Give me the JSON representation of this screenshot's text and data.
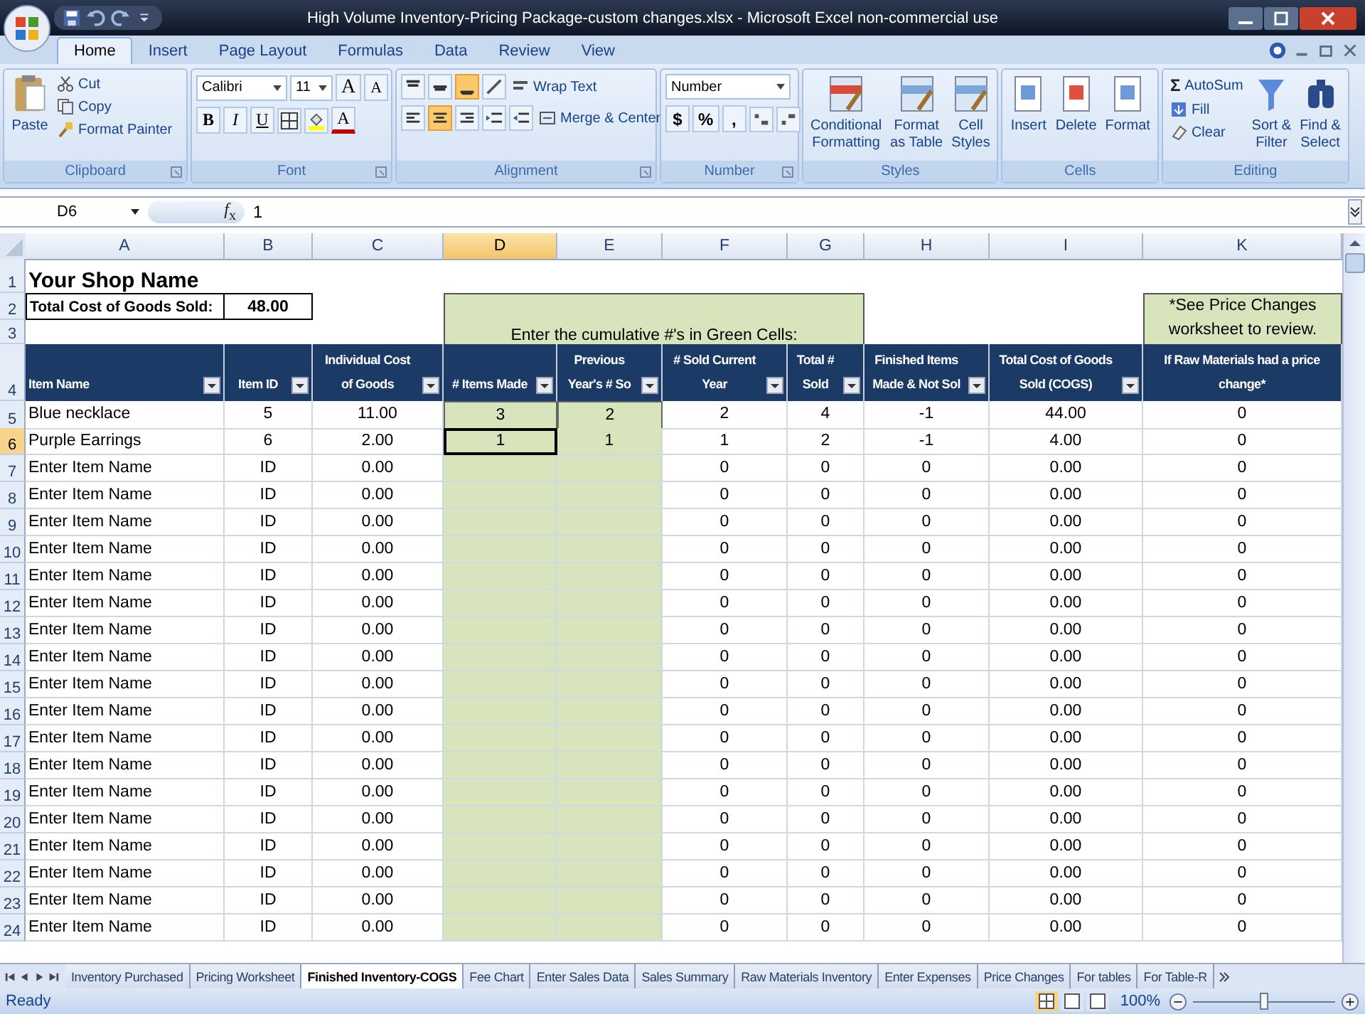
{
  "window": {
    "title": "High Volume Inventory-Pricing Package-custom changes.xlsx - Microsoft Excel non-commercial use"
  },
  "ribbon_tabs": [
    {
      "label": "Home",
      "selected": true
    },
    {
      "label": "Insert",
      "selected": false
    },
    {
      "label": "Page Layout",
      "selected": false
    },
    {
      "label": "Formulas",
      "selected": false
    },
    {
      "label": "Data",
      "selected": false
    },
    {
      "label": "Review",
      "selected": false
    },
    {
      "label": "View",
      "selected": false
    }
  ],
  "ribbon": {
    "clipboard": {
      "paste": "Paste",
      "items": [
        "Cut",
        "Copy",
        "Format Painter"
      ],
      "label": "Clipboard"
    },
    "font": {
      "font_name": "Calibri",
      "font_size": "11",
      "grow": "A",
      "shrink": "A",
      "styles": [
        "B",
        "I",
        "U"
      ],
      "font_color": "A",
      "label": "Font"
    },
    "alignment": {
      "vertical": [
        {
          "selected": false
        },
        {
          "selected": false
        },
        {
          "selected": true
        }
      ],
      "horizontal": [
        {
          "selected": false
        },
        {
          "selected": true
        },
        {
          "selected": false
        }
      ],
      "wrap_text": "Wrap Text",
      "merge": "Merge & Center",
      "label": "Alignment"
    },
    "number": {
      "format": "Number",
      "symbols": [
        "$",
        "%",
        ","
      ],
      "label": "Number"
    },
    "styles": {
      "buttons": [
        {
          "lines": [
            "Conditional",
            "Formatting"
          ]
        },
        {
          "lines": [
            "Format",
            "as Table"
          ]
        },
        {
          "lines": [
            "Cell",
            "Styles"
          ]
        }
      ],
      "label": "Styles"
    },
    "cells": {
      "buttons": [
        "Insert",
        "Delete",
        "Format"
      ],
      "label": "Cells"
    },
    "editing": {
      "sigma": "Σ",
      "autosum": "AutoSum",
      "fill": "Fill",
      "clear": "Clear",
      "buttons": [
        {
          "lines": [
            "Sort &",
            "Filter"
          ]
        },
        {
          "lines": [
            "Find &",
            "Select"
          ]
        }
      ],
      "label": "Editing"
    }
  },
  "formula_bar": {
    "name_box": "D6",
    "fx": "*f*$_{x}$",
    "value": "1"
  },
  "columns": [
    {
      "label": "A",
      "selected": false
    },
    {
      "label": "B",
      "selected": false
    },
    {
      "label": "C",
      "selected": false
    },
    {
      "label": "D",
      "selected": true
    },
    {
      "label": "E",
      "selected": false
    },
    {
      "label": "F",
      "selected": false
    },
    {
      "label": "G",
      "selected": false
    },
    {
      "label": "H",
      "selected": false
    },
    {
      "label": "I",
      "selected": false
    },
    {
      "label": "K",
      "selected": false
    }
  ],
  "sheet": {
    "title_row": {
      "number": "1",
      "text": "Your Shop Name"
    },
    "total_row": {
      "number": "2",
      "label": "Total Cost of Goods Sold:",
      "value": "48.00"
    },
    "spacer_row": {
      "number": "3"
    },
    "green_banner": "Enter the cumulative #'s in Green Cells:",
    "note": "*See Price Changes worksheet to review.",
    "header_row": {
      "number": "4",
      "cells": [
        {
          "lines": [
            "Item Name"
          ],
          "filter": true
        },
        {
          "lines": [
            "Item ID"
          ],
          "filter": true
        },
        {
          "lines": [
            "Individual Cost",
            "of Goods"
          ],
          "filter": true
        },
        {
          "lines": [
            "# Items Made"
          ],
          "filter": true
        },
        {
          "lines": [
            "Previous",
            "Year's # So"
          ],
          "filter": true
        },
        {
          "lines": [
            "# Sold Current",
            "Year"
          ],
          "filter": true
        },
        {
          "lines": [
            "Total #",
            "Sold"
          ],
          "filter": true
        },
        {
          "lines": [
            "Finished Items",
            "Made & Not Sol"
          ],
          "filter": true
        },
        {
          "lines": [
            "Total Cost of Goods",
            "Sold (COGS)"
          ],
          "filter": true
        },
        {
          "lines": [
            "If Raw Materials had a price",
            "change*"
          ],
          "filter": false
        }
      ]
    },
    "rows": [
      {
        "number": "5",
        "selected": false,
        "item_name": "Blue necklace",
        "item_id": "5",
        "cost": "11.00",
        "items_made": "3",
        "previous_sold": "2",
        "sold_current": "2",
        "total_sold": "4",
        "not_sold": "-1",
        "cogs": "44.00",
        "price_change": "0"
      },
      {
        "number": "6",
        "selected": true,
        "item_name": "Purple Earrings",
        "item_id": "6",
        "cost": "2.00",
        "items_made": "1",
        "previous_sold": "1",
        "sold_current": "1",
        "total_sold": "2",
        "not_sold": "-1",
        "cogs": "4.00",
        "price_change": "0"
      },
      {
        "number": "7",
        "selected": false,
        "item_name": "Enter Item Name",
        "item_id": "ID",
        "cost": "0.00",
        "sold_current": "0",
        "total_sold": "0",
        "not_sold": "0",
        "cogs": "0.00",
        "price_change": "0"
      },
      {
        "number": "8",
        "selected": false,
        "item_name": "Enter Item Name",
        "item_id": "ID",
        "cost": "0.00",
        "sold_current": "0",
        "total_sold": "0",
        "not_sold": "0",
        "cogs": "0.00",
        "price_change": "0"
      },
      {
        "number": "9",
        "selected": false,
        "item_name": "Enter Item Name",
        "item_id": "ID",
        "cost": "0.00",
        "sold_current": "0",
        "total_sold": "0",
        "not_sold": "0",
        "cogs": "0.00",
        "price_change": "0"
      },
      {
        "number": "10",
        "selected": false,
        "item_name": "Enter Item Name",
        "item_id": "ID",
        "cost": "0.00",
        "sold_current": "0",
        "total_sold": "0",
        "not_sold": "0",
        "cogs": "0.00",
        "price_change": "0"
      },
      {
        "number": "11",
        "selected": false,
        "item_name": "Enter Item Name",
        "item_id": "ID",
        "cost": "0.00",
        "sold_current": "0",
        "total_sold": "0",
        "not_sold": "0",
        "cogs": "0.00",
        "price_change": "0"
      },
      {
        "number": "12",
        "selected": false,
        "item_name": "Enter Item Name",
        "item_id": "ID",
        "cost": "0.00",
        "sold_current": "0",
        "total_sold": "0",
        "not_sold": "0",
        "cogs": "0.00",
        "price_change": "0"
      },
      {
        "number": "13",
        "selected": false,
        "item_name": "Enter Item Name",
        "item_id": "ID",
        "cost": "0.00",
        "sold_current": "0",
        "total_sold": "0",
        "not_sold": "0",
        "cogs": "0.00",
        "price_change": "0"
      },
      {
        "number": "14",
        "selected": false,
        "item_name": "Enter Item Name",
        "item_id": "ID",
        "cost": "0.00",
        "sold_current": "0",
        "total_sold": "0",
        "not_sold": "0",
        "cogs": "0.00",
        "price_change": "0"
      },
      {
        "number": "15",
        "selected": false,
        "item_name": "Enter Item Name",
        "item_id": "ID",
        "cost": "0.00",
        "sold_current": "0",
        "total_sold": "0",
        "not_sold": "0",
        "cogs": "0.00",
        "price_change": "0"
      },
      {
        "number": "16",
        "selected": false,
        "item_name": "Enter Item Name",
        "item_id": "ID",
        "cost": "0.00",
        "sold_current": "0",
        "total_sold": "0",
        "not_sold": "0",
        "cogs": "0.00",
        "price_change": "0"
      },
      {
        "number": "17",
        "selected": false,
        "item_name": "Enter Item Name",
        "item_id": "ID",
        "cost": "0.00",
        "sold_current": "0",
        "total_sold": "0",
        "not_sold": "0",
        "cogs": "0.00",
        "price_change": "0"
      },
      {
        "number": "18",
        "selected": false,
        "item_name": "Enter Item Name",
        "item_id": "ID",
        "cost": "0.00",
        "sold_current": "0",
        "total_sold": "0",
        "not_sold": "0",
        "cogs": "0.00",
        "price_change": "0"
      },
      {
        "number": "19",
        "selected": false,
        "item_name": "Enter Item Name",
        "item_id": "ID",
        "cost": "0.00",
        "sold_current": "0",
        "total_sold": "0",
        "not_sold": "0",
        "cogs": "0.00",
        "price_change": "0"
      },
      {
        "number": "20",
        "selected": false,
        "item_name": "Enter Item Name",
        "item_id": "ID",
        "cost": "0.00",
        "sold_current": "0",
        "total_sold": "0",
        "not_sold": "0",
        "cogs": "0.00",
        "price_change": "0"
      },
      {
        "number": "21",
        "selected": false,
        "item_name": "Enter Item Name",
        "item_id": "ID",
        "cost": "0.00",
        "sold_current": "0",
        "total_sold": "0",
        "not_sold": "0",
        "cogs": "0.00",
        "price_change": "0"
      },
      {
        "number": "22",
        "selected": false,
        "item_name": "Enter Item Name",
        "item_id": "ID",
        "cost": "0.00",
        "sold_current": "0",
        "total_sold": "0",
        "not_sold": "0",
        "cogs": "0.00",
        "price_change": "0"
      },
      {
        "number": "23",
        "selected": false,
        "item_name": "Enter Item Name",
        "item_id": "ID",
        "cost": "0.00",
        "sold_current": "0",
        "total_sold": "0",
        "not_sold": "0",
        "cogs": "0.00",
        "price_change": "0"
      },
      {
        "number": "24",
        "selected": false,
        "item_name": "Enter Item Name",
        "item_id": "ID",
        "cost": "0.00",
        "sold_current": "0",
        "total_sold": "0",
        "not_sold": "0",
        "cogs": "0.00",
        "price_change": "0"
      }
    ]
  },
  "sheet_tabs": [
    {
      "label": "Inventory Purchased",
      "selected": false
    },
    {
      "label": "Pricing Worksheet",
      "selected": false
    },
    {
      "label": "Finished Inventory-COGS",
      "selected": true
    },
    {
      "label": "Fee Chart",
      "selected": false
    },
    {
      "label": "Enter Sales Data",
      "selected": false
    },
    {
      "label": "Sales Summary",
      "selected": false
    },
    {
      "label": "Raw Materials Inventory",
      "selected": false
    },
    {
      "label": "Enter Expenses",
      "selected": false
    },
    {
      "label": "Price Changes",
      "selected": false
    },
    {
      "label": "For tables",
      "selected": false
    },
    {
      "label": "For Table-R",
      "selected": false
    }
  ],
  "status_bar": {
    "text": "Ready",
    "views": [
      {
        "selected": true
      },
      {
        "selected": false
      },
      {
        "selected": false
      }
    ],
    "zoom": "100%",
    "zoom_slider": {
      "level": 0.5
    }
  }
}
